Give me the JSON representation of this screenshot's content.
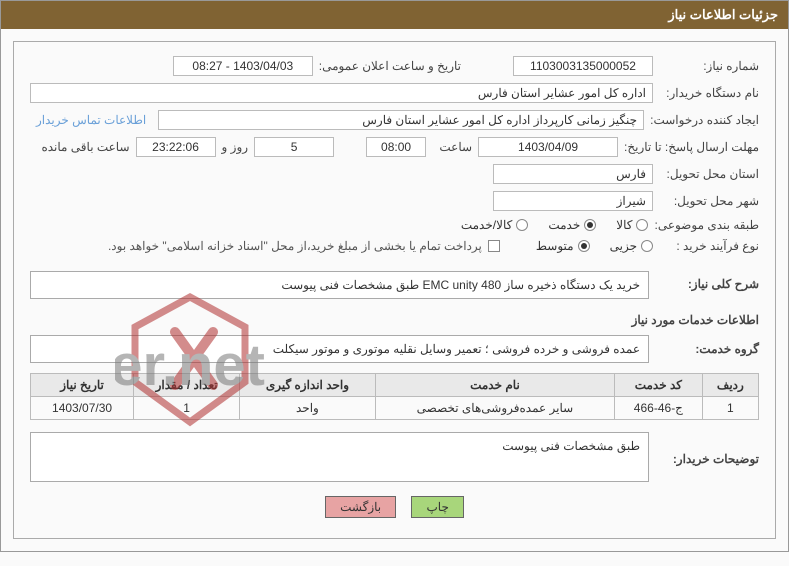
{
  "header": {
    "title": "جزئیات اطلاعات نیاز"
  },
  "fields": {
    "need_no_label": "شماره نیاز:",
    "need_no": "1103003135000052",
    "publish_dt_label": "تاریخ و ساعت اعلان عمومی:",
    "publish_dt": "1403/04/03 - 08:27",
    "buyer_org_label": "نام دستگاه خریدار:",
    "buyer_org": "اداره کل امور عشایر استان فارس",
    "requester_label": "ایجاد کننده درخواست:",
    "requester": "چنگیز زمانی کارپرداز اداره کل امور عشایر استان فارس",
    "contact_info": "اطلاعات تماس خریدار",
    "deadline_label": "مهلت ارسال پاسخ: تا تاریخ:",
    "deadline_date": "1403/04/09",
    "time_label": "ساعت",
    "deadline_time": "08:00",
    "days": "5",
    "days_suffix": "روز و",
    "time_remaining": "23:22:06",
    "remaining_suffix": "ساعت باقی مانده",
    "province_label": "استان محل تحویل:",
    "province": "فارس",
    "city_label": "شهر محل تحویل:",
    "city": "شیراز",
    "category_label": "طبقه بندی موضوعی:",
    "radio_kala": "کالا",
    "radio_khadmat": "خدمت",
    "radio_kalakhadmat": "کالا/خدمت",
    "purchase_type_label": "نوع فرآیند خرید :",
    "radio_jozi": "جزیی",
    "radio_motevaset": "متوسط",
    "payment_note": "پرداخت تمام یا بخشی از مبلغ خرید،از محل \"اسناد خزانه اسلامی\" خواهد بود."
  },
  "desc": {
    "need_desc_label": "شرح کلی نیاز:",
    "need_desc": "خرید یک دستگاه ذخیره ساز EMC unity 480 طبق مشخصات فنی پیوست",
    "service_info_heading": "اطلاعات خدمات مورد نیاز",
    "service_group_label": "گروه خدمت:",
    "service_group": "عمده فروشی و خرده فروشی ؛ تعمیر وسایل نقلیه موتوری و موتور سیکلت"
  },
  "table": {
    "headers": {
      "row": "ردیف",
      "code": "کد خدمت",
      "name": "نام خدمت",
      "unit": "واحد اندازه گیری",
      "qty": "تعداد / مقدار",
      "date": "تاریخ نیاز"
    },
    "rows": [
      {
        "row": "1",
        "code": "ج-46-466",
        "name": "سایر عمده‌فروشی‌های تخصصی",
        "unit": "واحد",
        "qty": "1",
        "date": "1403/07/30"
      }
    ]
  },
  "buyer_note": {
    "label": "توضیحات خریدار:",
    "text": "طبق مشخصات فنی پیوست"
  },
  "buttons": {
    "print": "چاپ",
    "back": "بازگشت"
  }
}
